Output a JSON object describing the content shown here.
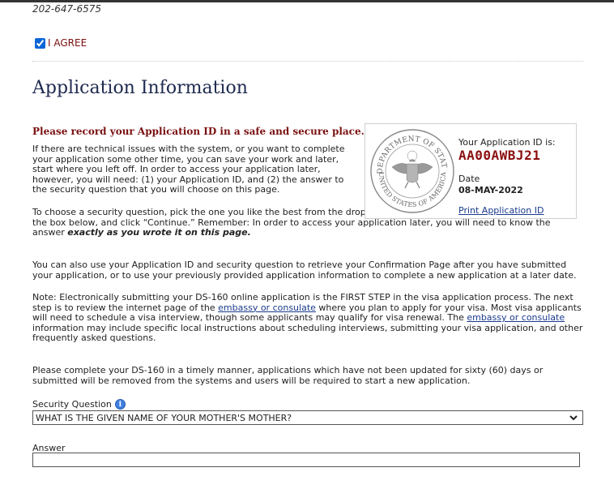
{
  "phone": "202-647-6575",
  "agree": {
    "label": "I AGREE",
    "checked": true
  },
  "title": "Application Information",
  "record_heading": "Please record your Application ID in a safe and secure place.",
  "paragraphs": {
    "p1": "If there are technical issues with the system, or you want to complete your application some other time, you can save your work and later, start where you left off. In order to access your application later, however, you will need: (1) your Application ID, and (2) the answer to the security question that you will choose on this page.",
    "p2_a": "To choose a security question, pick the one you like the best from the dropdown list, type your answer to that question in the box below, and click “Continue.” Remember: In order to access your application later, you will need to know the answer ",
    "p2_b": "exactly as you wrote it on this page.",
    "p3": "You can also use your Application ID and security question to retrieve your Confirmation Page after you have submitted your application, or to use your previously provided application information to complete a new application at a later date.",
    "p4_a": "Note: Electronically submitting your DS-160 online application is the FIRST STEP in the visa application process. The next step is to review the internet page of the ",
    "p4_link1": "embassy or consulate",
    "p4_b": " where you plan to apply for your visa. Most visa applicants will need to schedule a visa interview, though some applicants may qualify for visa renewal. The ",
    "p4_link2": "embassy or consulate",
    "p4_c": " information may include specific local instructions about scheduling interviews, submitting your visa application, and other frequently asked questions.",
    "p5": "Please complete your DS-160 in a timely manner, applications which have not been updated for sixty (60) days or submitted will be removed from the systems and users will be required to start a new application."
  },
  "id_box": {
    "label": "Your Application ID is:",
    "value": "AA00AWBJ21",
    "date_label": "Date",
    "date_value": "08-MAY-2022",
    "print_link": "Print Application ID",
    "seal_text_top": "DEPARTMENT OF STATE",
    "seal_text_bottom": "UNITED STATES OF AMERICA"
  },
  "security_question": {
    "label": "Security Question",
    "selected": "WHAT IS THE GIVEN NAME OF YOUR MOTHER'S MOTHER?"
  },
  "answer": {
    "label": "Answer",
    "value": ""
  },
  "icons": {
    "info": "info-icon",
    "dropdown": "chevron-down-icon",
    "seal": "department-of-state-seal"
  },
  "colors": {
    "maroon": "#7a1010",
    "id_red": "#8b0f0f",
    "link": "#1a3a8c",
    "title": "#1f2a4f"
  }
}
